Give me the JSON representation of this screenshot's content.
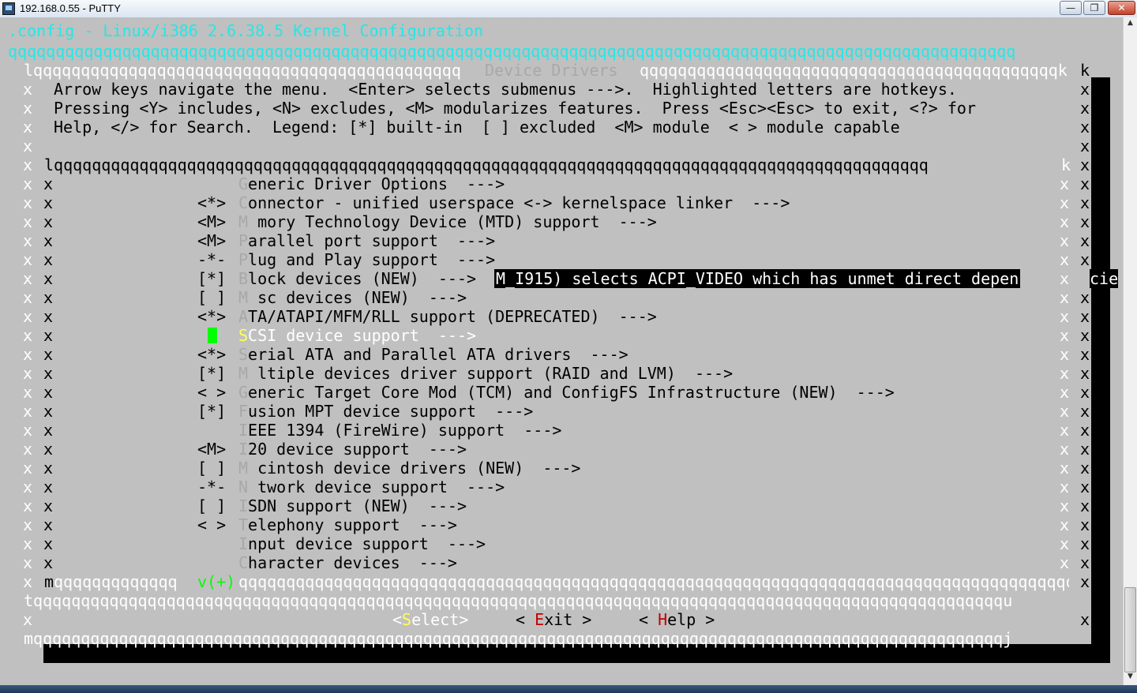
{
  "window": {
    "title": "192.168.0.55 - PuTTY",
    "buttons": {
      "minimize": "—",
      "maximize": "❐",
      "close": "✕"
    },
    "icon": "putty-icon"
  },
  "header": {
    "title": ".config - Linux/i386 2.6.38.5 Kernel Configuration",
    "separator": "qqqqqqqqqqqqqqqqqqqqqqqqqqqqqqqqqqqqqqqqqqqqqqqqqqqqqqqqqqqqqqqqqqqqqqqqqqqqqqqqqqqqqqqqqqqqqqqqqqqqqqqqqq"
  },
  "dialog": {
    "top_border_left": "lqqqqqqqqqqqqqqqqqqqqqqqqqqqqqqqqqqqqqqqqqqqqq",
    "title": "Device Drivers",
    "top_border_right": "qqqqqqqqqqqqqqqqqqqqqqqqqqqqqqqqqqqqqqqqqqqqk",
    "help_lines": [
      "Arrow keys navigate the menu.  <Enter> selects submenus --->.  Highlighted letters are hotkeys.",
      "Pressing <Y> includes, <N> excludes, <M> modularizes features.  Press <Esc><Esc> to exit, <?> for",
      "Help, </> for Search.  Legend: [*] built-in  [ ] excluded  <M> module  < > module capable"
    ],
    "menu_top_border": "lqqqqqqqqqqqqqqqqqqqqqqqqqqqqqqqqqqqqqqqqqqqqqqqqqqqqqqqqqqqqqqqqqqqqqqqqqqqqqqqqqqqqqqqqqqqq",
    "menu_top_corner": "k",
    "menu_bottom_left": "m",
    "menu_bottom_before": "qqqqqqqqqqqqq",
    "scroll_indicator": "v(+)",
    "menu_bottom_after": "qqqqqqqqqqqqqqqqqqqqqqqqqqqqqqqqqqqqqqqqqqqqqqqqqqqqqqqqqqqqqqqqqqqqqqqqqqqqqqqqqqqqqqqqqqqj",
    "button_separator": "tqqqqqqqqqqqqqqqqqqqqqqqqqqqqqqqqqqqqqqqqqqqqqqqqqqqqqqqqqqqqqqqqqqqqqqqqqqqqqqqqqqqqqqqqqqqqqqqqqqqqqqu",
    "bottom_border": "mqqqqqqqqqqqqqqqqqqqqqqqqqqqqqqqqqqqqqqqqqqqqqqqqqqqqqqqqqqqqqqqqqqqqqqqqqqqqqqqqqqqqqqqqqqqqqqqqqqqqqqj",
    "border_char": "x",
    "buttons": {
      "select": {
        "open": "<",
        "hotkey": "S",
        "rest": "elect",
        "close": ">"
      },
      "exit": {
        "open": "< ",
        "hotkey": "E",
        "rest": "xit",
        "close": " >"
      },
      "help": {
        "open": "< ",
        "hotkey": "H",
        "rest": "elp",
        "close": " >"
      }
    }
  },
  "menu": {
    "selected_index": 8,
    "items": [
      {
        "prefix": "",
        "hotkey": "G",
        "text": "eneric Driver Options  --->"
      },
      {
        "prefix": "<*>",
        "hotkey": "C",
        "text": "onnector - unified userspace <-> kernelspace linker  --->"
      },
      {
        "prefix": "<M>",
        "hotkey": "M",
        "text": "M mory Technology Device (MTD) support  --->"
      },
      {
        "prefix": "<M>",
        "hotkey": "P",
        "text": "arallel port support  --->"
      },
      {
        "prefix": "-*-",
        "hotkey": "P",
        "text": "lug and Play support  --->"
      },
      {
        "prefix": "[*]",
        "hotkey": "B",
        "text": "lock devices (NEW)  --->"
      },
      {
        "prefix": "[ ]",
        "hotkey": "M",
        "text": "M sc devices (NEW)  --->"
      },
      {
        "prefix": "<*>",
        "hotkey": "A",
        "text": "TA/ATAPI/MFM/RLL support (DEPRECATED)  --->"
      },
      {
        "prefix": "",
        "hotkey": "S",
        "text": "CSI device support  --->"
      },
      {
        "prefix": "<*>",
        "hotkey": "S",
        "text": "erial ATA and Parallel ATA drivers  --->"
      },
      {
        "prefix": "[*]",
        "hotkey": "M",
        "text": "M ltiple devices driver support (RAID and LVM)  --->"
      },
      {
        "prefix": "< >",
        "hotkey": "G",
        "text": "eneric Target Core Mod (TCM) and ConfigFS Infrastructure (NEW)  --->"
      },
      {
        "prefix": "[*]",
        "hotkey": "F",
        "text": "usion MPT device support  --->"
      },
      {
        "prefix": "",
        "hotkey": "I",
        "text": "EEE 1394 (FireWire) support  --->"
      },
      {
        "prefix": "<M>",
        "hotkey": "I",
        "text": "20 device support  --->"
      },
      {
        "prefix": "[ ]",
        "hotkey": "M",
        "text": "M cintosh device drivers (NEW)  --->"
      },
      {
        "prefix": "-*-",
        "hotkey": "N",
        "text": "N twork device support  --->"
      },
      {
        "prefix": "[ ]",
        "hotkey": "I",
        "text": "SDN support (NEW)  --->"
      },
      {
        "prefix": "< >",
        "hotkey": "T",
        "text": "elephony support  --->"
      },
      {
        "prefix": "",
        "hotkey": "I",
        "text": "nput device support  --->"
      },
      {
        "prefix": "",
        "hotkey": "C",
        "text": "haracter devices  --->"
      }
    ]
  },
  "overlay_message": {
    "text": "M_I915) selects ACPI_VIDEO which has unmet direct depen",
    "tail": "cie"
  },
  "colors": {
    "terminal_bg": "#c0c0c0",
    "shadow": "#000000",
    "header_cyan": "#27e6e6",
    "frame_white": "#ffffff",
    "hotkey_yellow": "#ffff55",
    "hotkey_red": "#c40000",
    "cursor_green": "#00ff00"
  }
}
